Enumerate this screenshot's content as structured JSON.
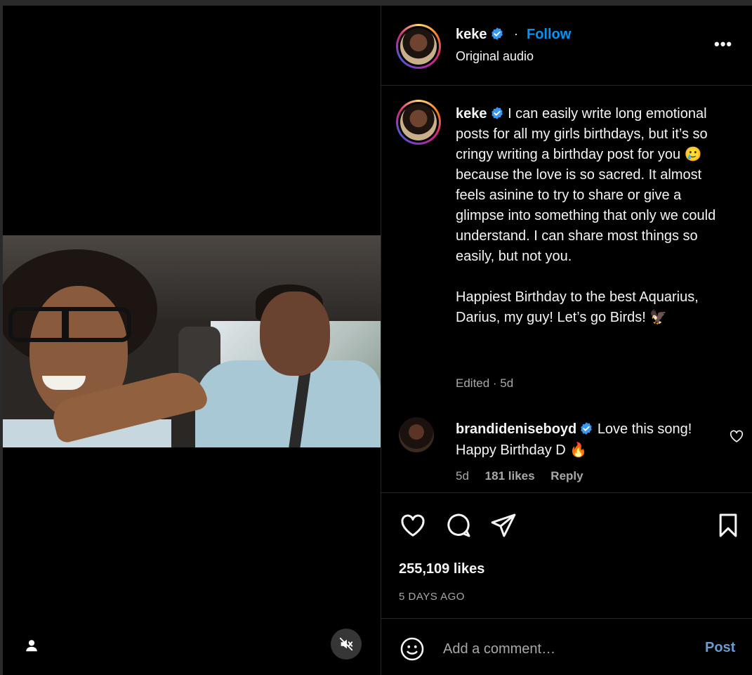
{
  "colors": {
    "accent": "#0095f6",
    "verified": "#3897f0",
    "muted": "#a8a8a8",
    "post": "#6b9bd1"
  },
  "header": {
    "username": "keke",
    "separator": "·",
    "follow_label": "Follow",
    "audio": "Original audio",
    "more_label": "•••"
  },
  "caption": {
    "username": "keke",
    "text_1": "I can easily write long emotional posts for all my girls birthdays, but it’s so cringy writing a birthday post for you",
    "emoji_1": "🥲",
    "text_2": "because the love is so sacred. It almost feels asinine to try to share or give a glimpse into something that only we could understand. I can share most things so easily, but not you.",
    "text_3": "Happiest Birthday to the best Aquarius, Darius, my guy! Let’s go Birds!",
    "emoji_2": "🦅",
    "meta": "Edited · 5d"
  },
  "comment": {
    "username": "brandideniseboyd",
    "text": "Love this song! Happy Birthday D",
    "emoji": "🔥",
    "time": "5d",
    "likes": "181 likes",
    "reply_label": "Reply"
  },
  "actions": {
    "icons": [
      "heart-icon",
      "comment-icon",
      "share-icon",
      "bookmark-icon"
    ],
    "likes": "255,109 likes",
    "date": "5 DAYS AGO"
  },
  "composer": {
    "placeholder": "Add a comment…",
    "post_label": "Post"
  }
}
